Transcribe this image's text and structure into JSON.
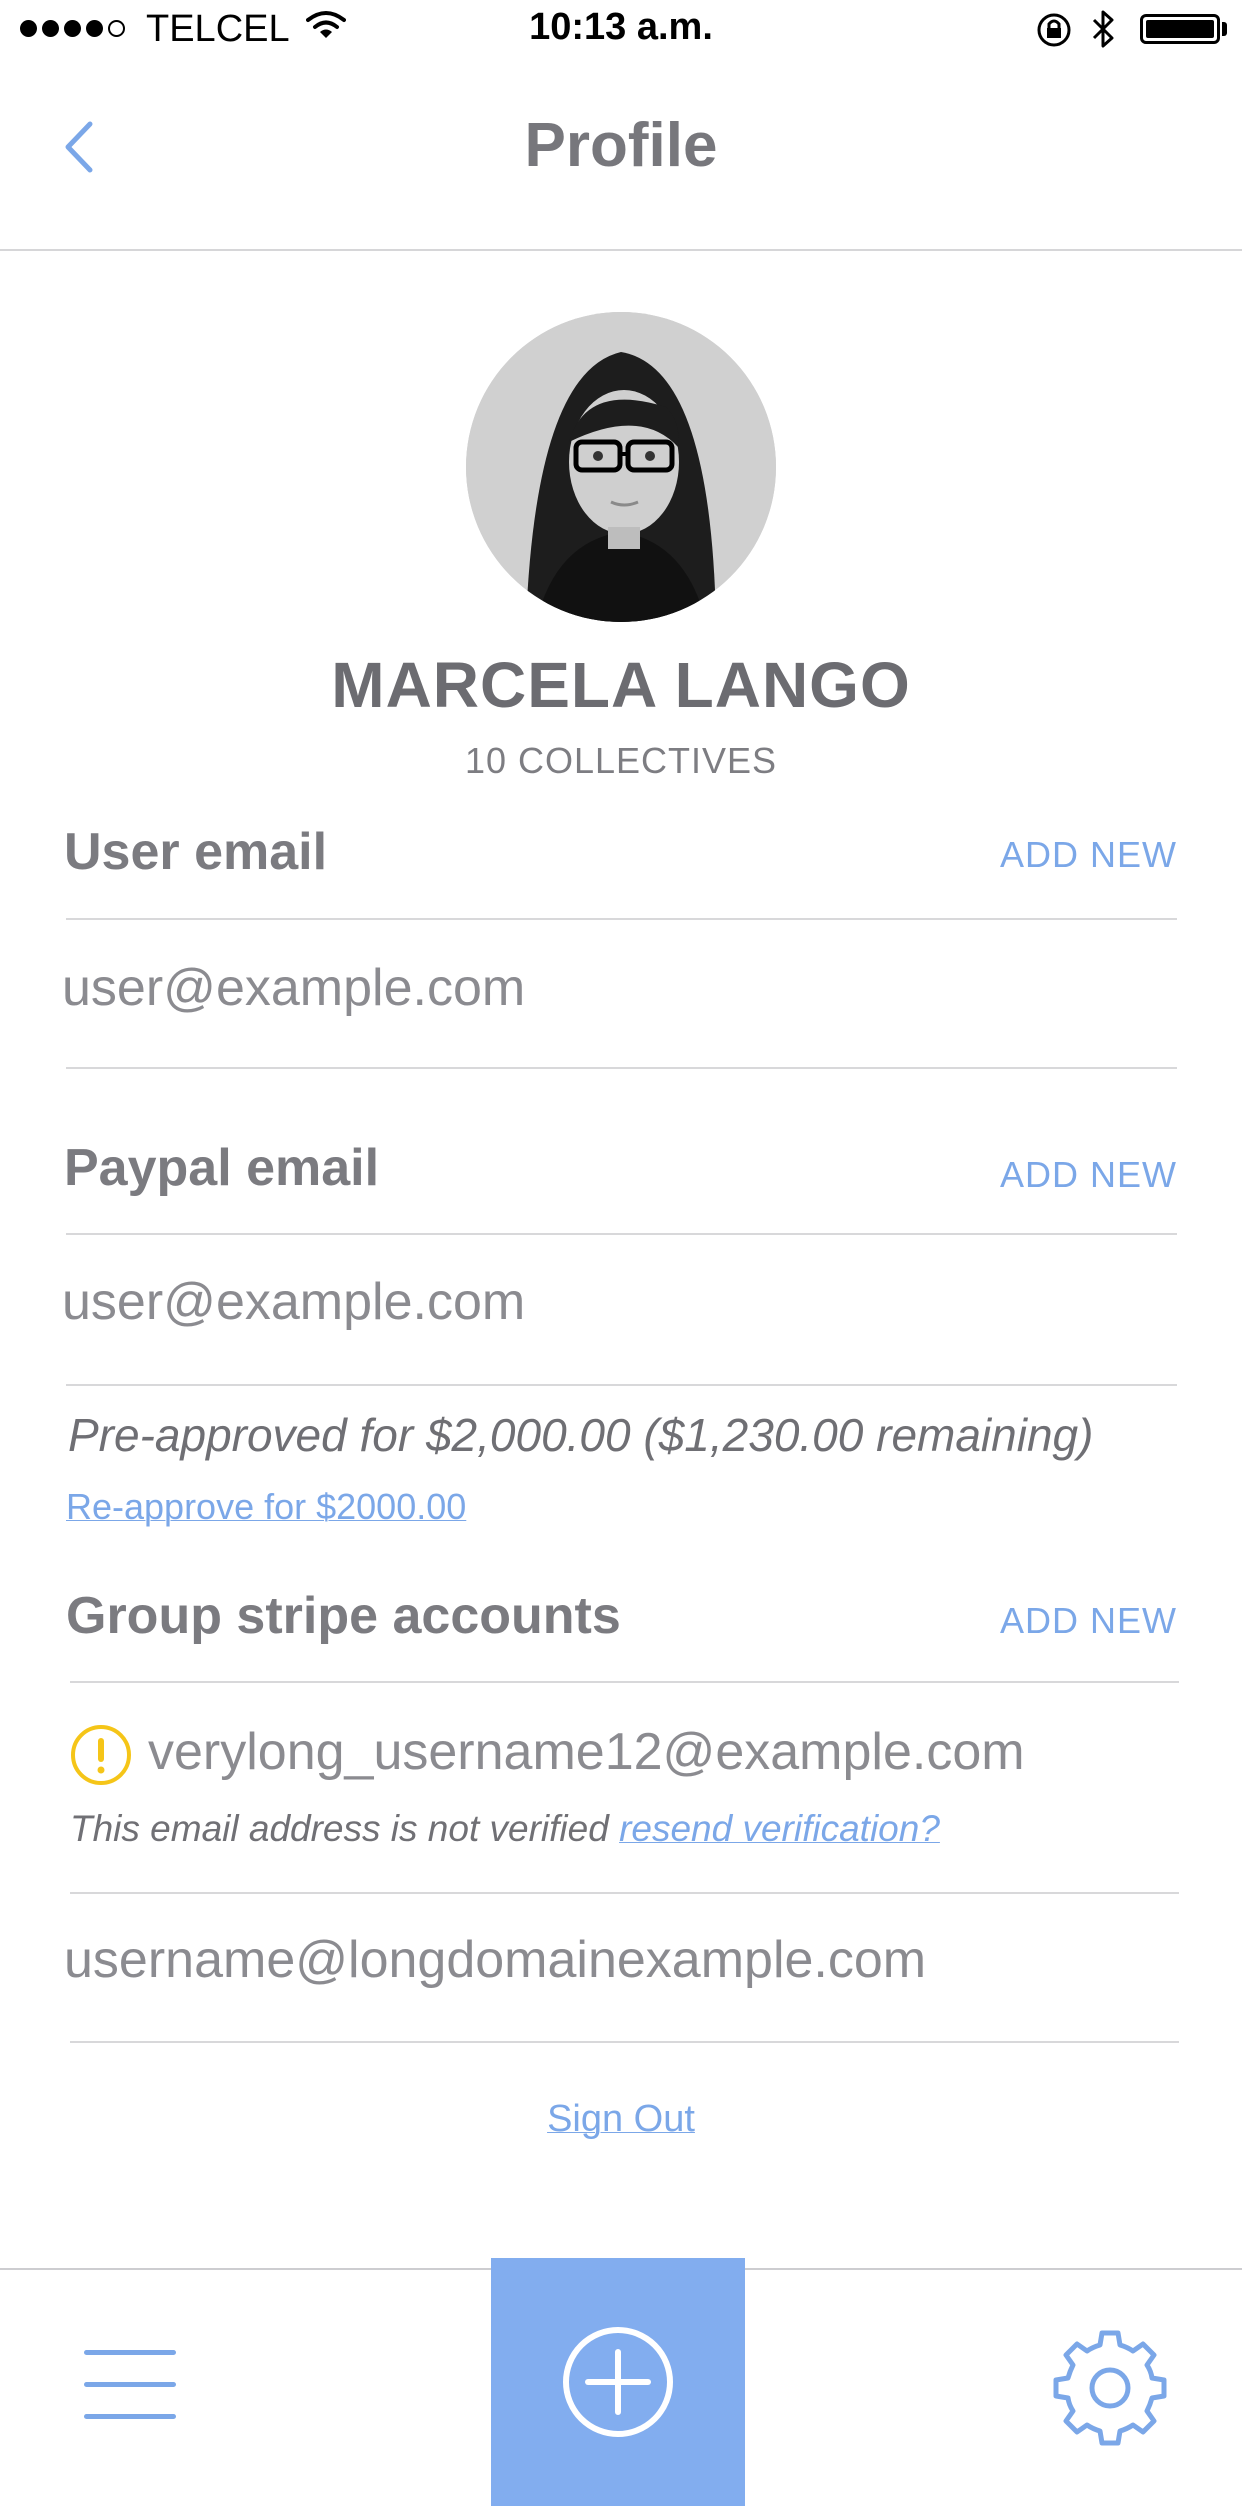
{
  "status_bar": {
    "carrier": "TELCEL",
    "time": "10:13 a.m."
  },
  "nav": {
    "title": "Profile"
  },
  "profile": {
    "name": "MARCELA LANGO",
    "collectives": "10 COLLECTIVES"
  },
  "user_email": {
    "heading": "User email",
    "add_label": "ADD NEW",
    "email": "user@example.com"
  },
  "paypal_email": {
    "heading": "Paypal email",
    "add_label": "ADD NEW",
    "email": "user@example.com",
    "preapproved_note": "Pre-approved for $2,000.00 ($1,230.00 remaining)",
    "reapprove_link": "Re-approve for $2000.00"
  },
  "stripe": {
    "heading": "Group stripe accounts",
    "add_label": "ADD NEW",
    "accounts": [
      {
        "email": "verylong_username12@example.com",
        "warning": "This email address is not verified",
        "action": "resend verification?"
      },
      {
        "email": "username@longdomainexample.com"
      }
    ]
  },
  "sign_out": "Sign Out",
  "tab_bar": {
    "left_icon": "hamburger-menu-icon",
    "center_icon": "plus-circle-icon",
    "right_icon": "gear-icon"
  },
  "colors": {
    "accent": "#7ba7e8",
    "fab": "#82adef",
    "warning": "#f5c518"
  }
}
